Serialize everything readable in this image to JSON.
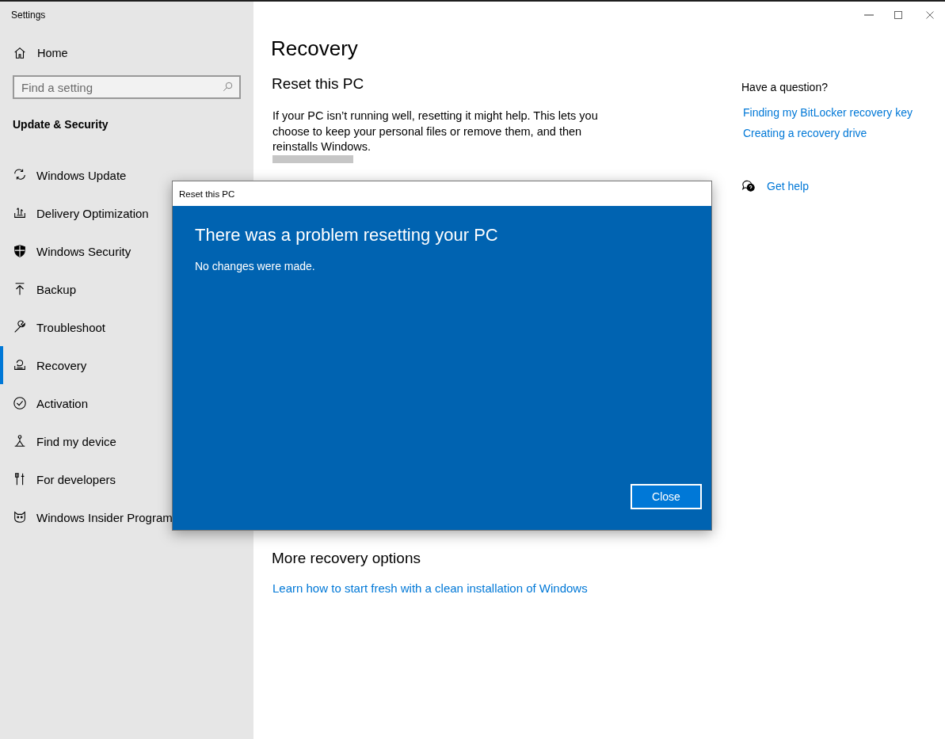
{
  "window": {
    "title": "Settings"
  },
  "sidebar": {
    "home": "Home",
    "search": {
      "placeholder": "Find a setting"
    },
    "section": "Update & Security",
    "items": [
      {
        "label": "Windows Update",
        "selected": false
      },
      {
        "label": "Delivery Optimization",
        "selected": false
      },
      {
        "label": "Windows Security",
        "selected": false
      },
      {
        "label": "Backup",
        "selected": false
      },
      {
        "label": "Troubleshoot",
        "selected": false
      },
      {
        "label": "Recovery",
        "selected": true
      },
      {
        "label": "Activation",
        "selected": false
      },
      {
        "label": "Find my device",
        "selected": false
      },
      {
        "label": "For developers",
        "selected": false
      },
      {
        "label": "Windows Insider Program",
        "selected": false
      }
    ]
  },
  "main": {
    "title": "Recovery",
    "reset": {
      "heading": "Reset this PC",
      "description": "If your PC isn’t running well, resetting it might help. This lets you choose to keep your personal files or remove them, and then reinstalls Windows."
    },
    "more": {
      "heading": "More recovery options",
      "link": "Learn how to start fresh with a clean installation of Windows"
    }
  },
  "help": {
    "heading": "Have a question?",
    "links": [
      "Finding my BitLocker recovery key",
      "Creating a recovery drive"
    ],
    "get_help": "Get help"
  },
  "dialog": {
    "title": "Reset this PC",
    "heading": "There was a problem resetting your PC",
    "message": "No changes were made.",
    "button": "Close"
  }
}
